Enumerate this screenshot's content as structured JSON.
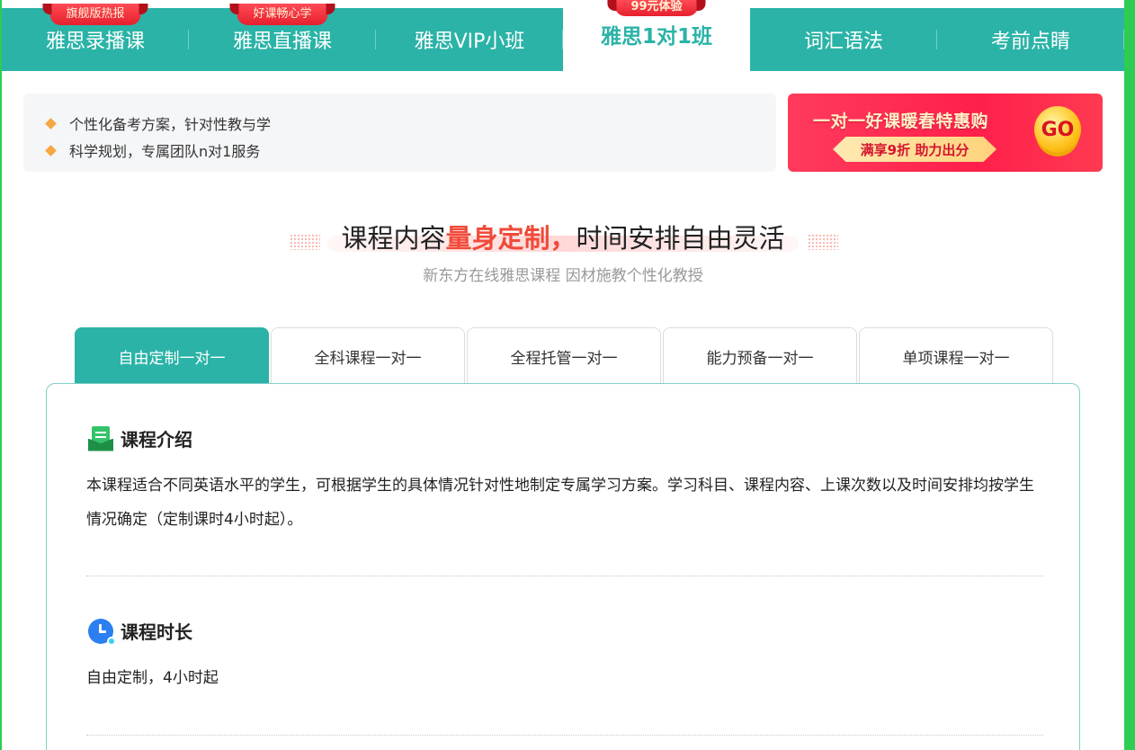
{
  "topnav": {
    "items": [
      {
        "label": "雅思录播课",
        "badge": "旗舰版热报"
      },
      {
        "label": "雅思直播课",
        "badge": "好课畅心学"
      },
      {
        "label": "雅思VIP小班",
        "badge": ""
      },
      {
        "label": "雅思1对1班",
        "badge": "99元体验"
      },
      {
        "label": "词汇语法",
        "badge": ""
      },
      {
        "label": "考前点睛",
        "badge": ""
      }
    ],
    "active_index": 3
  },
  "features": [
    "个性化备考方案，针对性教与学",
    "科学规划，专属团队n对1服务"
  ],
  "promo": {
    "title": "一对一好课暖春特惠购",
    "subtitle": "满享9折 助力出分",
    "go": "GO"
  },
  "heading": {
    "part1": "课程内容",
    "highlight": "量身定制，",
    "part2": "时间安排自由灵活",
    "subtitle": "新东方在线雅思课程 因材施教个性化教授"
  },
  "tabs": [
    "自由定制一对一",
    "全科课程一对一",
    "全程托管一对一",
    "能力预备一对一",
    "单项课程一对一"
  ],
  "content": {
    "intro_title": "课程介绍",
    "intro_text": "本课程适合不同英语水平的学生，可根据学生的具体情况针对性地制定专属学习方案。学习科目、课程内容、上课次数以及时间安排均按学生情况确定（定制课时4小时起）。",
    "duration_title": "课程时长",
    "duration_text": "自由定制，4小时起"
  },
  "colors": {
    "primary": "#2bb3a7",
    "accent": "#f04a3a",
    "frame": "#2ecc52"
  }
}
